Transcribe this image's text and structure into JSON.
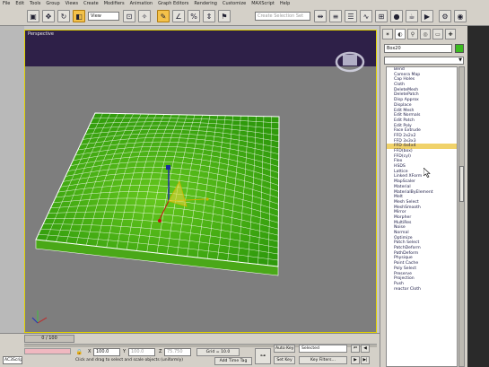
{
  "menu": [
    "File",
    "Edit",
    "Tools",
    "Group",
    "Views",
    "Create",
    "Modifiers",
    "Animation",
    "Graph Editors",
    "Rendering",
    "Customize",
    "MAXScript",
    "Help"
  ],
  "toolbar": {
    "view_dropdown": "View",
    "selection_set_placeholder": "Create Selection Set"
  },
  "viewport": {
    "label": "Perspective"
  },
  "command_panel": {
    "tabs": [
      "create-tab",
      "modify-tab",
      "hierarchy-tab",
      "motion-tab",
      "display-tab",
      "utilities-tab"
    ],
    "object_name": "Box20",
    "object_color": "#3cbc20",
    "modifier_list": [
      "Bend",
      "Camera Map",
      "Cap Holes",
      "Cloth",
      "DeleteMesh",
      "DeletePatch",
      "Disp Approx",
      "Displace",
      "Edit Mesh",
      "Edit Normals",
      "Edit Patch",
      "Edit Poly",
      "Face Extrude",
      "FFD 2x2x2",
      "FFD 3x3x3",
      "FFD 4x4x4",
      "FFD(box)",
      "FFD(cyl)",
      "Flex",
      "HSDS",
      "Lattice",
      "Linked XForm",
      "MapScaler",
      "Material",
      "MaterialByElement",
      "Melt",
      "Mesh Select",
      "MeshSmooth",
      "Mirror",
      "Morpher",
      "MultiRes",
      "Noise",
      "Normal",
      "Optimize",
      "Patch Select",
      "PatchDeform",
      "PathDeform",
      "Physique",
      "Point Cache",
      "Poly Select",
      "Preserve",
      "Projection",
      "Push",
      "reactor Cloth"
    ],
    "selected_modifier": "FFD 4x4x4"
  },
  "timeline": {
    "frame_display": "0 / 100"
  },
  "bottom": {
    "maxscript_text": "AC3Script...",
    "status_text": "Click and drag to select and scale objects (uniformly)",
    "x_label": "X",
    "x_value": "100.0",
    "y_label": "Y",
    "y_value": "100.0",
    "z_label": "Z",
    "z_value": "75.750",
    "grid_text": "Grid = 10.0",
    "add_time_tag": "Add Time Tag",
    "auto_key": "Auto Key",
    "set_key": "Set Key",
    "selected_dropdown": "Selected",
    "key_filters": "Key Filters..."
  },
  "colors": {
    "mesh_green": "#5cc020",
    "wire": "#ffffff",
    "viewport_bg": "#7e7e7e",
    "highlight": "#f0d26a"
  }
}
